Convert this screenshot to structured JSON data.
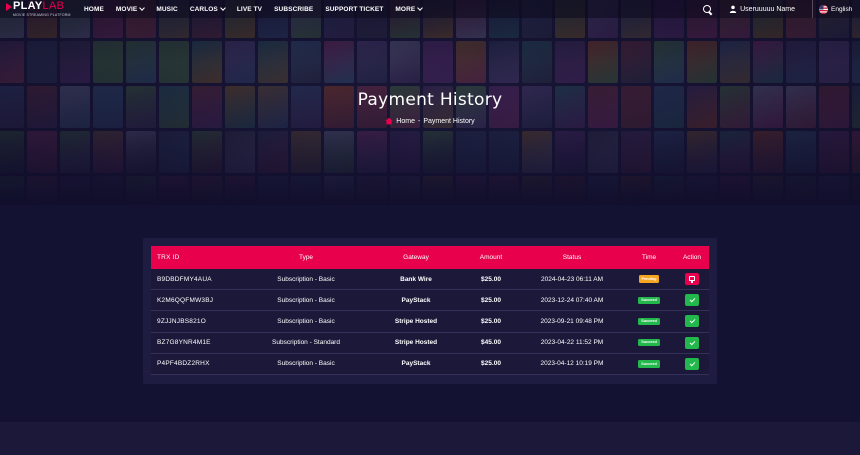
{
  "logo": {
    "play": "PLAY",
    "lab": "LAB",
    "tagline": "MOVIE STREAMING PLATFORM"
  },
  "nav": {
    "items": [
      {
        "label": "HOME",
        "dropdown": false
      },
      {
        "label": "MOVIE",
        "dropdown": true
      },
      {
        "label": "MUSIC",
        "dropdown": false
      },
      {
        "label": "CARLOS",
        "dropdown": true
      },
      {
        "label": "LIVE TV",
        "dropdown": false
      },
      {
        "label": "SUBSCRIBE",
        "dropdown": false
      },
      {
        "label": "SUPPORT TICKET",
        "dropdown": false
      },
      {
        "label": "MORE",
        "dropdown": true
      }
    ],
    "user_name": "Useruuuuu Name",
    "language": "English"
  },
  "page": {
    "title": "Payment History",
    "breadcrumb": {
      "home": "Home",
      "sep": "-",
      "current": "Payment History"
    }
  },
  "table": {
    "headers": [
      "TRX ID",
      "Type",
      "Gateway",
      "Amount",
      "Status",
      "Time",
      "Action"
    ],
    "rows": [
      {
        "trx": "B9DBDFMY4AUA",
        "type": "Subscription - Basic",
        "gateway": "Bank Wire",
        "amount": "$25.00",
        "date": "2024-04-23 06:11 AM",
        "status": "Pending",
        "action": "details"
      },
      {
        "trx": "K2M6QQFMW3BJ",
        "type": "Subscription - Basic",
        "gateway": "PayStack",
        "amount": "$25.00",
        "date": "2023-12-24 07:40 AM",
        "status": "Succeed",
        "action": "check"
      },
      {
        "trx": "9ZJJNJBS821O",
        "type": "Subscription - Basic",
        "gateway": "Stripe Hosted",
        "amount": "$25.00",
        "date": "2023-09-21 09:48 PM",
        "status": "Succeed",
        "action": "check"
      },
      {
        "trx": "BZ7G8YNR4M1E",
        "type": "Subscription - Standard",
        "gateway": "Stripe Hosted",
        "amount": "$45.00",
        "date": "2023-04-22 11:52 PM",
        "status": "Succeed",
        "action": "check"
      },
      {
        "trx": "P4PF4BDZ2RHX",
        "type": "Subscription - Basic",
        "gateway": "PayStack",
        "amount": "$25.00",
        "date": "2023-04-12 10:19 PM",
        "status": "Succeed",
        "action": "check"
      }
    ]
  },
  "colors": {
    "accent": "#e8004d",
    "pending": "#f5a623",
    "succeed": "#22b84c",
    "background": "#141233"
  }
}
